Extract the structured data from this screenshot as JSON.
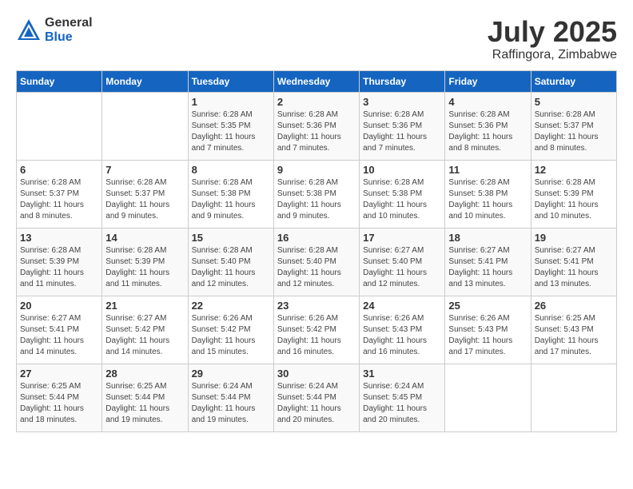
{
  "header": {
    "logo_general": "General",
    "logo_blue": "Blue",
    "month": "July 2025",
    "location": "Raffingora, Zimbabwe"
  },
  "weekdays": [
    "Sunday",
    "Monday",
    "Tuesday",
    "Wednesday",
    "Thursday",
    "Friday",
    "Saturday"
  ],
  "weeks": [
    [
      {
        "day": "",
        "info": ""
      },
      {
        "day": "",
        "info": ""
      },
      {
        "day": "1",
        "info": "Sunrise: 6:28 AM\nSunset: 5:35 PM\nDaylight: 11 hours and 7 minutes."
      },
      {
        "day": "2",
        "info": "Sunrise: 6:28 AM\nSunset: 5:36 PM\nDaylight: 11 hours and 7 minutes."
      },
      {
        "day": "3",
        "info": "Sunrise: 6:28 AM\nSunset: 5:36 PM\nDaylight: 11 hours and 7 minutes."
      },
      {
        "day": "4",
        "info": "Sunrise: 6:28 AM\nSunset: 5:36 PM\nDaylight: 11 hours and 8 minutes."
      },
      {
        "day": "5",
        "info": "Sunrise: 6:28 AM\nSunset: 5:37 PM\nDaylight: 11 hours and 8 minutes."
      }
    ],
    [
      {
        "day": "6",
        "info": "Sunrise: 6:28 AM\nSunset: 5:37 PM\nDaylight: 11 hours and 8 minutes."
      },
      {
        "day": "7",
        "info": "Sunrise: 6:28 AM\nSunset: 5:37 PM\nDaylight: 11 hours and 9 minutes."
      },
      {
        "day": "8",
        "info": "Sunrise: 6:28 AM\nSunset: 5:38 PM\nDaylight: 11 hours and 9 minutes."
      },
      {
        "day": "9",
        "info": "Sunrise: 6:28 AM\nSunset: 5:38 PM\nDaylight: 11 hours and 9 minutes."
      },
      {
        "day": "10",
        "info": "Sunrise: 6:28 AM\nSunset: 5:38 PM\nDaylight: 11 hours and 10 minutes."
      },
      {
        "day": "11",
        "info": "Sunrise: 6:28 AM\nSunset: 5:38 PM\nDaylight: 11 hours and 10 minutes."
      },
      {
        "day": "12",
        "info": "Sunrise: 6:28 AM\nSunset: 5:39 PM\nDaylight: 11 hours and 10 minutes."
      }
    ],
    [
      {
        "day": "13",
        "info": "Sunrise: 6:28 AM\nSunset: 5:39 PM\nDaylight: 11 hours and 11 minutes."
      },
      {
        "day": "14",
        "info": "Sunrise: 6:28 AM\nSunset: 5:39 PM\nDaylight: 11 hours and 11 minutes."
      },
      {
        "day": "15",
        "info": "Sunrise: 6:28 AM\nSunset: 5:40 PM\nDaylight: 11 hours and 12 minutes."
      },
      {
        "day": "16",
        "info": "Sunrise: 6:28 AM\nSunset: 5:40 PM\nDaylight: 11 hours and 12 minutes."
      },
      {
        "day": "17",
        "info": "Sunrise: 6:27 AM\nSunset: 5:40 PM\nDaylight: 11 hours and 12 minutes."
      },
      {
        "day": "18",
        "info": "Sunrise: 6:27 AM\nSunset: 5:41 PM\nDaylight: 11 hours and 13 minutes."
      },
      {
        "day": "19",
        "info": "Sunrise: 6:27 AM\nSunset: 5:41 PM\nDaylight: 11 hours and 13 minutes."
      }
    ],
    [
      {
        "day": "20",
        "info": "Sunrise: 6:27 AM\nSunset: 5:41 PM\nDaylight: 11 hours and 14 minutes."
      },
      {
        "day": "21",
        "info": "Sunrise: 6:27 AM\nSunset: 5:42 PM\nDaylight: 11 hours and 14 minutes."
      },
      {
        "day": "22",
        "info": "Sunrise: 6:26 AM\nSunset: 5:42 PM\nDaylight: 11 hours and 15 minutes."
      },
      {
        "day": "23",
        "info": "Sunrise: 6:26 AM\nSunset: 5:42 PM\nDaylight: 11 hours and 16 minutes."
      },
      {
        "day": "24",
        "info": "Sunrise: 6:26 AM\nSunset: 5:43 PM\nDaylight: 11 hours and 16 minutes."
      },
      {
        "day": "25",
        "info": "Sunrise: 6:26 AM\nSunset: 5:43 PM\nDaylight: 11 hours and 17 minutes."
      },
      {
        "day": "26",
        "info": "Sunrise: 6:25 AM\nSunset: 5:43 PM\nDaylight: 11 hours and 17 minutes."
      }
    ],
    [
      {
        "day": "27",
        "info": "Sunrise: 6:25 AM\nSunset: 5:44 PM\nDaylight: 11 hours and 18 minutes."
      },
      {
        "day": "28",
        "info": "Sunrise: 6:25 AM\nSunset: 5:44 PM\nDaylight: 11 hours and 19 minutes."
      },
      {
        "day": "29",
        "info": "Sunrise: 6:24 AM\nSunset: 5:44 PM\nDaylight: 11 hours and 19 minutes."
      },
      {
        "day": "30",
        "info": "Sunrise: 6:24 AM\nSunset: 5:44 PM\nDaylight: 11 hours and 20 minutes."
      },
      {
        "day": "31",
        "info": "Sunrise: 6:24 AM\nSunset: 5:45 PM\nDaylight: 11 hours and 20 minutes."
      },
      {
        "day": "",
        "info": ""
      },
      {
        "day": "",
        "info": ""
      }
    ]
  ]
}
